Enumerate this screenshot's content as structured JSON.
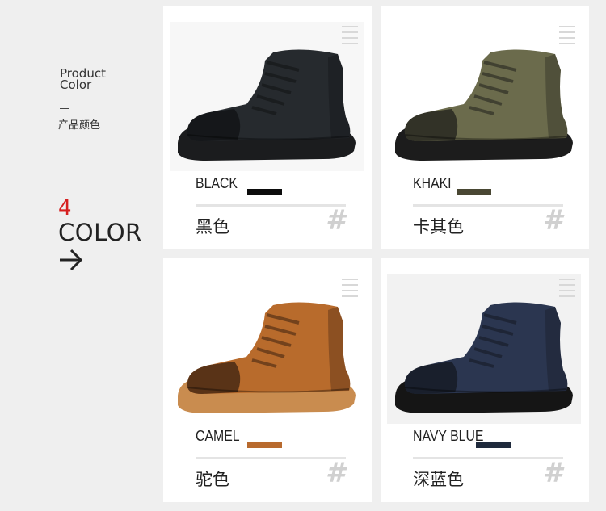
{
  "intro": {
    "title_en_line1": "Product",
    "title_en_line2": "Color",
    "title_dash": "—",
    "title_cn": "产品颜色",
    "count": "4",
    "count_label": "COLOR",
    "arrow_icon": "arrow-right-icon"
  },
  "colors": [
    {
      "name_en": "BLACK",
      "name_cn": "黑色",
      "swatch": "#0c0c0c",
      "shoe_body": "#262a2e",
      "shoe_toe": "#101214",
      "sole": "#1b1c1e",
      "hash": "#",
      "bg": "#f7f7f7"
    },
    {
      "name_en": "KHAKI",
      "name_cn": "卡其色",
      "swatch": "#494733",
      "shoe_body": "#6b6b4c",
      "shoe_toe": "#1f1f1b",
      "sole": "#1c1c1c",
      "hash": "#",
      "bg": "#ffffff"
    },
    {
      "name_en": "CAMEL",
      "name_cn": "驼色",
      "swatch": "#b86a2e",
      "shoe_body": "#b86b2c",
      "shoe_toe": "#3a2010",
      "sole": "#c98c4f",
      "hash": "#",
      "bg": "#ffffff"
    },
    {
      "name_en": "NAVY BLUE",
      "name_cn": "深蓝色",
      "swatch": "#1f2a3c",
      "shoe_body": "#2b3650",
      "shoe_toe": "#141820",
      "sole": "#151515",
      "hash": "#",
      "bg": "#f2f2f2"
    }
  ]
}
